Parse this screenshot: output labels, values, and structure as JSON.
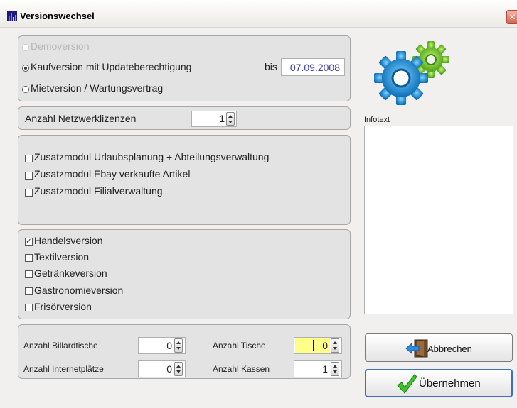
{
  "window": {
    "title": "Versionswechsel"
  },
  "version_group": {
    "demo_label": "Demoversion",
    "kauf_label": "Kaufversion mit Updateberechtigung",
    "bis_label": "bis",
    "bis_date": "07.09.2008",
    "miet_label": "Mietversion / Wartungsvertrag",
    "selected": "kauf"
  },
  "network": {
    "label": "Anzahl Netzwerklizenzen",
    "value": "1"
  },
  "modules": {
    "items": [
      {
        "label": "Zusatzmodul Urlaubsplanung + Abteilungsverwaltung",
        "checked": false
      },
      {
        "label": "Zusatzmodul Ebay verkaufte Artikel",
        "checked": false
      },
      {
        "label": "Zusatzmodul Filialverwaltung",
        "checked": false
      }
    ]
  },
  "editions": {
    "items": [
      {
        "label": "Handelsversion",
        "checked": true
      },
      {
        "label": "Textilversion",
        "checked": false
      },
      {
        "label": "Getränkeversion",
        "checked": false
      },
      {
        "label": "Gastronomieversion",
        "checked": false
      },
      {
        "label": "Frisörversion",
        "checked": false
      }
    ]
  },
  "counts": {
    "billard_label": "Anzahl Billardtische",
    "billard_value": "0",
    "internet_label": "Anzahl Internetplätze",
    "internet_value": "0",
    "tische_label": "Anzahl Tische",
    "tische_value": "0",
    "kassen_label": "Anzahl Kassen",
    "kassen_value": "1"
  },
  "info": {
    "label": "Infotext"
  },
  "buttons": {
    "cancel_label": "Abbrechen",
    "ok_label": "Übernehmen"
  },
  "colors": {
    "highlight_field": "#ffff88",
    "date_text": "#3a3ab0"
  }
}
